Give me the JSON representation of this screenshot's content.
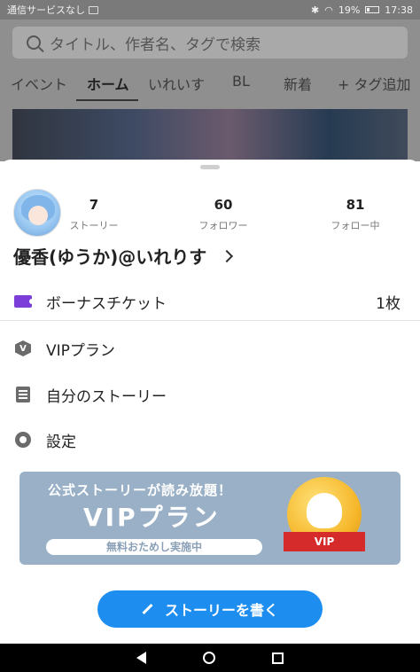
{
  "status_bar": {
    "carrier": "通信サービスなし",
    "battery": "19%",
    "time": "17:38"
  },
  "background": {
    "search_placeholder": "タイトル、作者名、タグで検索",
    "tabs": [
      "イベント",
      "ホーム",
      "いれいす",
      "BL",
      "新着",
      "+ タグ追加"
    ],
    "active_tab": "ホーム"
  },
  "profile": {
    "stats": [
      {
        "value": "7",
        "label": "ストーリー"
      },
      {
        "value": "60",
        "label": "フォロワー"
      },
      {
        "value": "81",
        "label": "フォロー中"
      }
    ],
    "name": "優香(ゆうか)@いれりす"
  },
  "menu": {
    "bonus_ticket_label": "ボーナスチケット",
    "bonus_ticket_value": "1枚",
    "vip_plan_label": "VIPプラン",
    "my_stories_label": "自分のストーリー",
    "settings_label": "設定"
  },
  "promo": {
    "tagline": "公式ストーリーが読み放題！",
    "title": "VIPプラン",
    "pill": "無料おためし実施中",
    "medal_text": "VIP",
    "accent": "#9ab0c7"
  },
  "actions": {
    "write_story": "ストーリーを書く",
    "accent": "#1d8ef0"
  }
}
